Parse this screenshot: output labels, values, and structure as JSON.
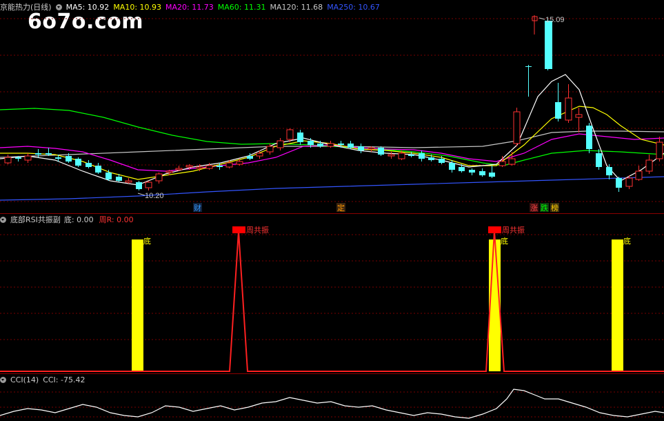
{
  "main": {
    "title": "京能热力(日线)",
    "ma": [
      {
        "label": "MA5: 10.92",
        "color": "#ffffff"
      },
      {
        "label": "MA10: 10.93",
        "color": "#ffff00"
      },
      {
        "label": "MA20: 11.73",
        "color": "#ff00ff"
      },
      {
        "label": "MA60: 11.31",
        "color": "#00ff00"
      },
      {
        "label": "MA120: 11.68",
        "color": "#c8c8c8"
      },
      {
        "label": "MA250: 10.67",
        "color": "#3355ff"
      }
    ],
    "watermark": "6o7o.com",
    "high_label": "15.09",
    "low_label": "10.20",
    "events": [
      {
        "text": "财",
        "color": "#3399ff"
      },
      {
        "text": "定",
        "color": "#ff9900"
      },
      {
        "text": "涨",
        "color": "#ff4444"
      },
      {
        "text": "跌",
        "color": "#00ff00"
      },
      {
        "text": "榜",
        "color": "#ffcc00"
      }
    ]
  },
  "rsi_panel": {
    "title": "底部RSI共振副",
    "di_label": "底: 0.00",
    "zhou_label": "周R: 0.00",
    "di_text": "底",
    "zhou_text": "周共振"
  },
  "cci_panel": {
    "title": "CCI(14)",
    "value_label": "CCI: -75.42"
  },
  "colors": {
    "up": "#ff3232",
    "down": "#54ffff",
    "grid": "#8b0000",
    "yellow": "#ffff00"
  }
}
